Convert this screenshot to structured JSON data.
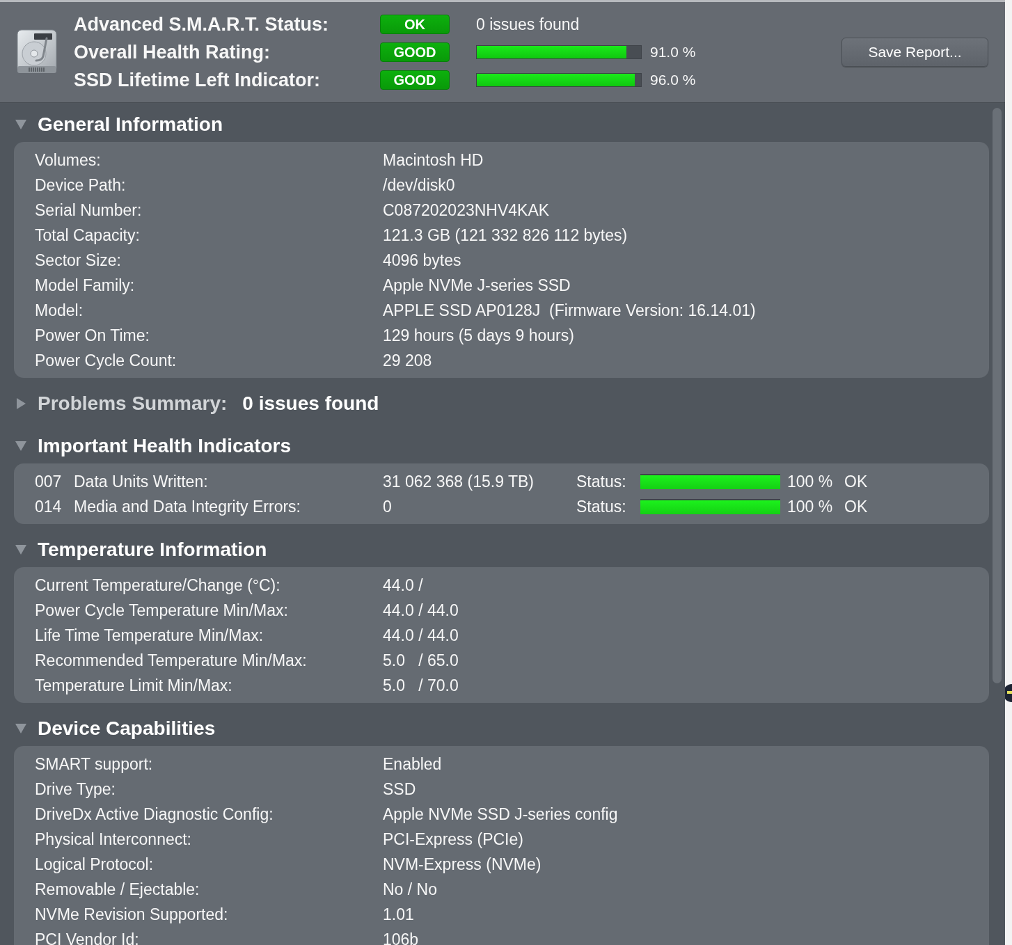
{
  "header": {
    "rows": [
      {
        "label": "Advanced S.M.A.R.T. Status:",
        "badge": "OK",
        "kind": "text",
        "text": "0 issues found"
      },
      {
        "label": "Overall Health Rating:",
        "badge": "GOOD",
        "kind": "meter",
        "level": 0.91,
        "reading": "91.0 %"
      },
      {
        "label": "SSD Lifetime Left Indicator:",
        "badge": "GOOD",
        "kind": "meter",
        "level": 0.96,
        "reading": "96.0 %"
      }
    ],
    "save_button": "Save Report..."
  },
  "sections": [
    {
      "title": "General Information",
      "expanded": true,
      "kind": "details",
      "rows": [
        {
          "label": "Volumes:",
          "value": "Macintosh HD"
        },
        {
          "label": "Device Path:",
          "value": "/dev/disk0"
        },
        {
          "label": "Serial Number:",
          "value": "C087202023NHV4KAK"
        },
        {
          "label": "Total Capacity:",
          "value": "121.3 GB (121 332 826 112 bytes)"
        },
        {
          "label": "Sector Size:",
          "value": "4096 bytes"
        },
        {
          "label": "Model Family:",
          "value": "Apple NVMe J-series SSD"
        },
        {
          "label": "Model:",
          "value": "APPLE SSD AP0128J  (Firmware Version: 16.14.01)"
        },
        {
          "label": "Power On Time:",
          "value": "129 hours (5 days 9 hours)"
        },
        {
          "label": "Power Cycle Count:",
          "value": "29 208"
        }
      ]
    },
    {
      "title": "Problems Summary:",
      "expanded": false,
      "kind": "summary",
      "summary": "0 issues found"
    },
    {
      "title": "Important Health Indicators",
      "expanded": true,
      "kind": "indicators",
      "rows": [
        {
          "id": "007",
          "name": "Data Units Written:",
          "value": "31 062 368 (15.9 TB)",
          "status_label": "Status:",
          "level": 1.0,
          "reading": "100 %",
          "status": "OK"
        },
        {
          "id": "014",
          "name": "Media and Data Integrity Errors:",
          "value": "0",
          "status_label": "Status:",
          "level": 1.0,
          "reading": "100 %",
          "status": "OK"
        }
      ]
    },
    {
      "title": "Temperature Information",
      "expanded": true,
      "kind": "details",
      "rows": [
        {
          "label": "Current Temperature/Change (°C):",
          "value": "44.0 /"
        },
        {
          "label": "Power Cycle Temperature Min/Max:",
          "value": "44.0 / 44.0"
        },
        {
          "label": "Life Time Temperature Min/Max:",
          "value": "44.0 / 44.0"
        },
        {
          "label": "Recommended Temperature Min/Max:",
          "value": "5.0   / 65.0"
        },
        {
          "label": "Temperature Limit Min/Max:",
          "value": "5.0   / 70.0"
        }
      ]
    },
    {
      "title": "Device Capabilities",
      "expanded": true,
      "kind": "details",
      "rows": [
        {
          "label": "SMART support:",
          "value": "Enabled"
        },
        {
          "label": "Drive Type:",
          "value": "SSD"
        },
        {
          "label": "DriveDx Active Diagnostic Config:",
          "value": "Apple NVMe SSD J-series config"
        },
        {
          "label": "Physical Interconnect:",
          "value": "PCI-Express (PCIe)"
        },
        {
          "label": "Logical Protocol:",
          "value": "NVM-Express (NVMe)"
        },
        {
          "label": "Removable / Ejectable:",
          "value": "No / No"
        },
        {
          "label": "NVMe Revision Supported:",
          "value": "1.01"
        },
        {
          "label": "PCI Vendor Id:",
          "value": "106b"
        }
      ]
    }
  ]
}
